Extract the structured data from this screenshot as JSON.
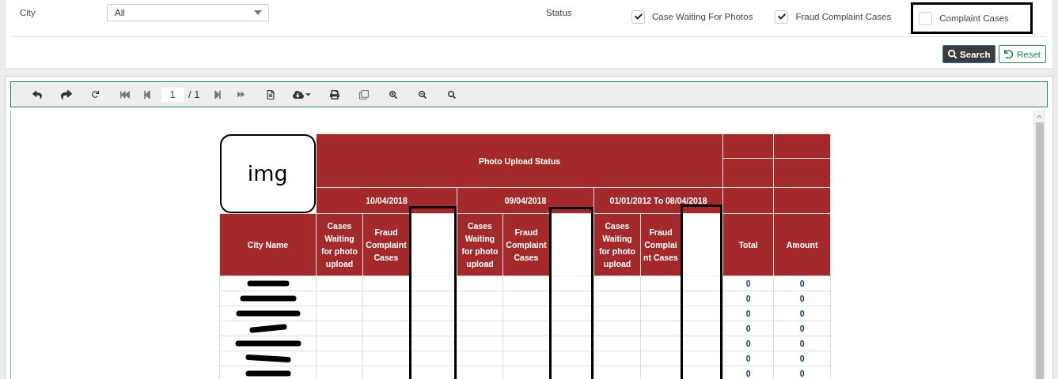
{
  "filters": {
    "city": {
      "label": "City",
      "value": "All"
    },
    "status": {
      "label": "Status",
      "options": [
        {
          "label": "Case Waiting For Photos",
          "checked": true,
          "annotated": false
        },
        {
          "label": "Fraud Complaint Cases",
          "checked": true,
          "annotated": false
        },
        {
          "label": "Complaint Cases",
          "checked": false,
          "annotated": true
        }
      ]
    }
  },
  "buttons": [
    {
      "label": "Search",
      "kind": "primary"
    },
    {
      "label": "Reset",
      "kind": "secondary"
    }
  ],
  "toolbar": {
    "page": "1",
    "page_total": "/ 1"
  },
  "report": {
    "logo": "img",
    "title": "Photo Upload Status",
    "city_header": "City Name",
    "total_header": "Total",
    "amount_header": "Amount",
    "groups": [
      {
        "date": "10/04/2018",
        "columns": [
          "Cases Waiting for photo upload",
          "Fraud Complaint Cases"
        ],
        "blank_column": true,
        "annotated": true
      },
      {
        "date": "09/04/2018",
        "columns": [
          "Cases Waiting for photo upload",
          "Fraud Complaint Cases"
        ],
        "blank_column": true,
        "annotated": true
      },
      {
        "date": "01/01/2012 To 08/04/2018",
        "columns": [
          "Cases Waiting for photo upload",
          "Fraud Complaint Cases"
        ],
        "blank_column": true,
        "annotated": true
      }
    ],
    "rows": [
      {
        "total": "0",
        "amount": "0"
      },
      {
        "total": "0",
        "amount": "0"
      },
      {
        "total": "0",
        "amount": "0"
      },
      {
        "total": "0",
        "amount": "0"
      },
      {
        "total": "0",
        "amount": "0"
      },
      {
        "total": "0",
        "amount": "0"
      },
      {
        "total": "0",
        "amount": "0"
      }
    ]
  }
}
